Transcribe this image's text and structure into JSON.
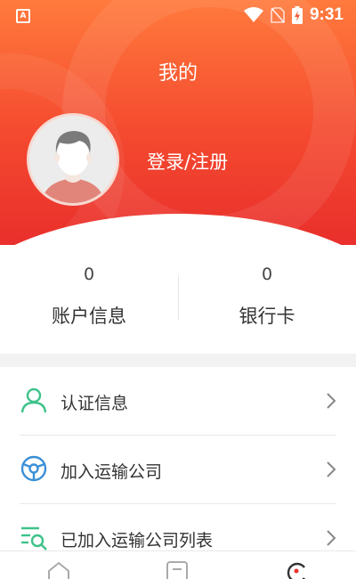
{
  "statusbar": {
    "time": "9:31",
    "app_icon_letter": "A",
    "icons": [
      "app-notification-icon",
      "wifi-icon",
      "no-sim-icon",
      "battery-charging-icon"
    ]
  },
  "header": {
    "title": "我的",
    "login_label": "登录/注册"
  },
  "stats": [
    {
      "value": "0",
      "label": "账户信息"
    },
    {
      "value": "0",
      "label": "银行卡"
    }
  ],
  "menu": [
    {
      "label": "认证信息",
      "icon": "user-verify-icon"
    },
    {
      "label": "加入运输公司",
      "icon": "steering-wheel-icon"
    },
    {
      "label": "已加入运输公司列表",
      "icon": "list-search-icon"
    }
  ],
  "tabbar": {
    "tabs": [
      {
        "icon": "home-icon",
        "active": false
      },
      {
        "icon": "orders-icon",
        "active": false
      },
      {
        "icon": "profile-icon",
        "active": true
      }
    ]
  },
  "colors": {
    "header_top": "#ff7a3c",
    "header_bottom": "#e92f2c",
    "menu_icon_green": "#3ec28a",
    "menu_icon_blue": "#3a8fd6",
    "active_tab": "#e8322c"
  }
}
